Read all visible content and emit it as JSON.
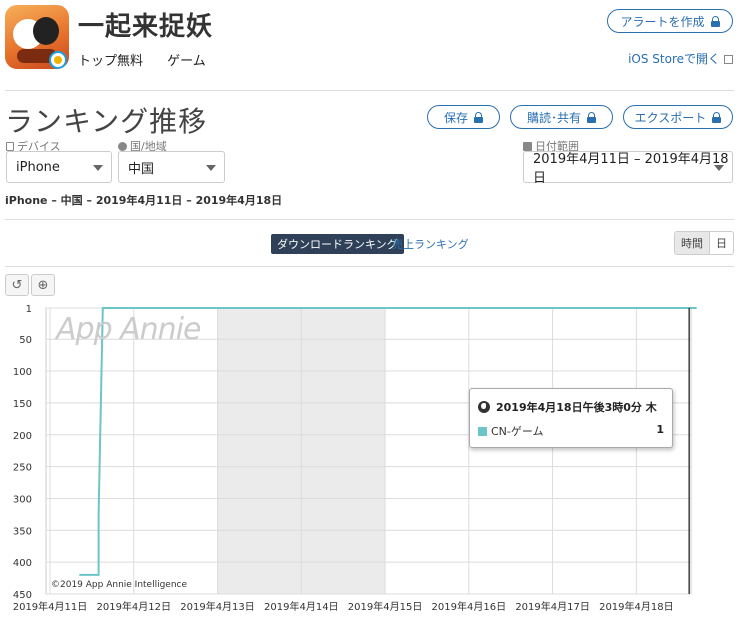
{
  "app": {
    "title": "一起来捉妖",
    "rank_type": "トップ無料",
    "category": "ゲーム"
  },
  "header": {
    "alert_button": "アラートを作成",
    "ios_store_link": "iOS Storeで開く"
  },
  "section": {
    "title": "ランキング推移",
    "save_button": "保存",
    "subscribe_button": "購読･共有",
    "export_button": "エクスポート"
  },
  "filters": {
    "device_label": "デバイス",
    "device_value": "iPhone",
    "country_label": "国/地域",
    "country_value": "中国",
    "date_label": "日付範囲",
    "date_value": "2019年4月11日 – 2019年4月18日"
  },
  "subtitle": "iPhone – 中国 – 2019年4月11日 – 2019年4月18日",
  "chart_controls": {
    "download_ranking": "ダウンロードランキング",
    "sales_ranking": "売上ランキング",
    "granularity_hour": "時間",
    "granularity_day": "日"
  },
  "tooltip": {
    "title": "2019年4月18日午後3時0分 木",
    "series": "CN-ゲーム",
    "value": "1"
  },
  "watermark": "App Annie",
  "copyright": "©2019 App Annie Intelligence",
  "colors": {
    "series_line": "#6cc5c9",
    "weekend_band": "#ebebeb",
    "accent": "#2a6fb0"
  },
  "chart_data": {
    "type": "line",
    "y_reversed": true,
    "ylim": [
      1,
      450
    ],
    "yticks": [
      1,
      50,
      100,
      150,
      200,
      250,
      300,
      350,
      400,
      450
    ],
    "x_categories": [
      "2019年4月11日",
      "2019年4月12日",
      "2019年4月13日",
      "2019年4月14日",
      "2019年4月15日",
      "2019年4月16日",
      "2019年4月17日",
      "2019年4月18日"
    ],
    "weekend_bands": [
      [
        2,
        4
      ]
    ],
    "cursor_x": 7.63,
    "series": [
      {
        "name": "CN-ゲーム",
        "points": [
          [
            0.35,
            420
          ],
          [
            0.58,
            420
          ],
          [
            0.58,
            325
          ],
          [
            0.63,
            1
          ],
          [
            7.72,
            1
          ]
        ]
      }
    ]
  }
}
